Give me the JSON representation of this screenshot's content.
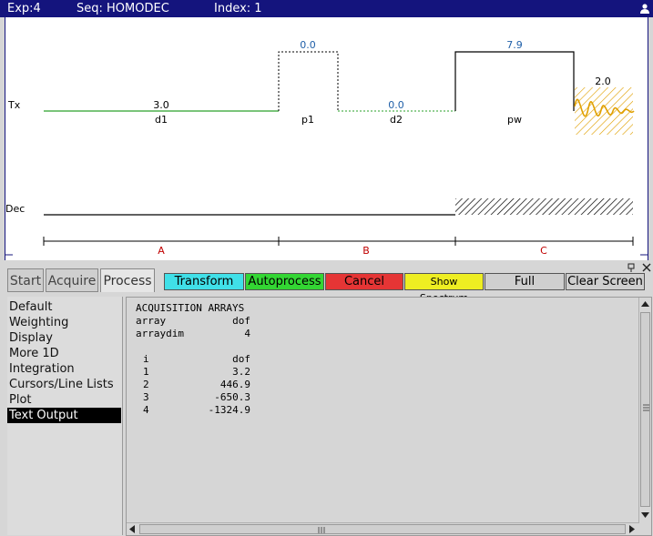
{
  "titlebar": {
    "exp": "Exp:4",
    "seq": "Seq: HOMODEC",
    "index": "Index: 1",
    "icon": "user-icon"
  },
  "sequence": {
    "channels": {
      "tx": "Tx",
      "dec": "Dec"
    },
    "tx_values": {
      "d1": "3.0",
      "p1": "0.0",
      "d2": "0.0",
      "pw": "7.9",
      "acq": "2.0"
    },
    "tx_labels": {
      "d1": "d1",
      "p1": "p1",
      "d2": "d2",
      "pw": "pw"
    },
    "segments": [
      "A",
      "B",
      "C"
    ],
    "colors": {
      "delay": "#2aa02a",
      "acquire": "#e0a000",
      "value": "#1f5fa8",
      "segment": "#c00000"
    }
  },
  "window_controls": {
    "pin": "pin-icon",
    "close": "close-icon"
  },
  "tabs": [
    "Start",
    "Acquire",
    "Process"
  ],
  "active_tab": "Process",
  "buttons": {
    "transform": "Transform",
    "autoprocess": "Autoprocess",
    "cancel": "Cancel",
    "show_spectrum": "Show Spectrum",
    "full": "Full",
    "clear_screen": "Clear Screen"
  },
  "button_colors": {
    "transform": "#40e0e8",
    "autoprocess": "#33d633",
    "cancel": "#e53535",
    "show_spectrum": "#eeee22",
    "full": "#cfcfcf",
    "clear_screen": "#cfcfcf"
  },
  "menu": {
    "items": [
      "Default",
      "Weighting",
      "Display",
      "More 1D",
      "Integration",
      "Cursors/Line Lists",
      "Plot",
      "Text Output"
    ],
    "selected": "Text Output"
  },
  "output": {
    "title": "ACQUISITION ARRAYS",
    "array_label": "array",
    "array_value": "dof",
    "arraydim_label": "arraydim",
    "arraydim_value": "4",
    "columns": [
      "i",
      "dof"
    ],
    "rows": [
      [
        "1",
        "3.2"
      ],
      [
        "2",
        "446.9"
      ],
      [
        "3",
        "-650.3"
      ],
      [
        "4",
        "-1324.9"
      ]
    ]
  }
}
